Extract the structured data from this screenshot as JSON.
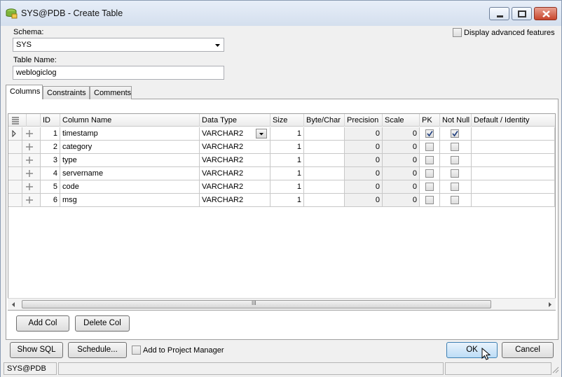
{
  "window": {
    "title": "SYS@PDB - Create Table"
  },
  "form": {
    "schema_label": "Schema:",
    "schema_value": "SYS",
    "table_name_label": "Table Name:",
    "table_name_value": "weblogiclog",
    "advanced_label": "Display advanced features"
  },
  "tabs": [
    {
      "label": "Columns",
      "active": true
    },
    {
      "label": "Constraints",
      "active": false
    },
    {
      "label": "Comments",
      "active": false
    }
  ],
  "grid": {
    "headers": {
      "id": "ID",
      "name": "Column Name",
      "type": "Data Type",
      "size": "Size",
      "bytechar": "Byte/Char",
      "precision": "Precision",
      "scale": "Scale",
      "pk": "PK",
      "notnull": "Not Null",
      "default": "Default / Identity"
    },
    "rows": [
      {
        "id": "1",
        "name": "timestamp",
        "type": "VARCHAR2",
        "size": "1",
        "precision": "0",
        "scale": "0",
        "pk": true,
        "notnull": true
      },
      {
        "id": "2",
        "name": "category",
        "type": "VARCHAR2",
        "size": "1",
        "precision": "0",
        "scale": "0",
        "pk": false,
        "notnull": false
      },
      {
        "id": "3",
        "name": "type",
        "type": "VARCHAR2",
        "size": "1",
        "precision": "0",
        "scale": "0",
        "pk": false,
        "notnull": false
      },
      {
        "id": "4",
        "name": "servername",
        "type": "VARCHAR2",
        "size": "1",
        "precision": "0",
        "scale": "0",
        "pk": false,
        "notnull": false
      },
      {
        "id": "5",
        "name": "code",
        "type": "VARCHAR2",
        "size": "1",
        "precision": "0",
        "scale": "0",
        "pk": false,
        "notnull": false
      },
      {
        "id": "6",
        "name": "msg",
        "type": "VARCHAR2",
        "size": "1",
        "precision": "0",
        "scale": "0",
        "pk": false,
        "notnull": false
      }
    ],
    "scroll_grip": "III"
  },
  "buttons": {
    "add_col": "Add Col",
    "delete_col": "Delete Col",
    "show_sql": "Show SQL",
    "schedule": "Schedule...",
    "add_to_project": "Add to Project Manager",
    "ok": "OK",
    "cancel": "Cancel"
  },
  "status": {
    "connection": "SYS@PDB"
  }
}
